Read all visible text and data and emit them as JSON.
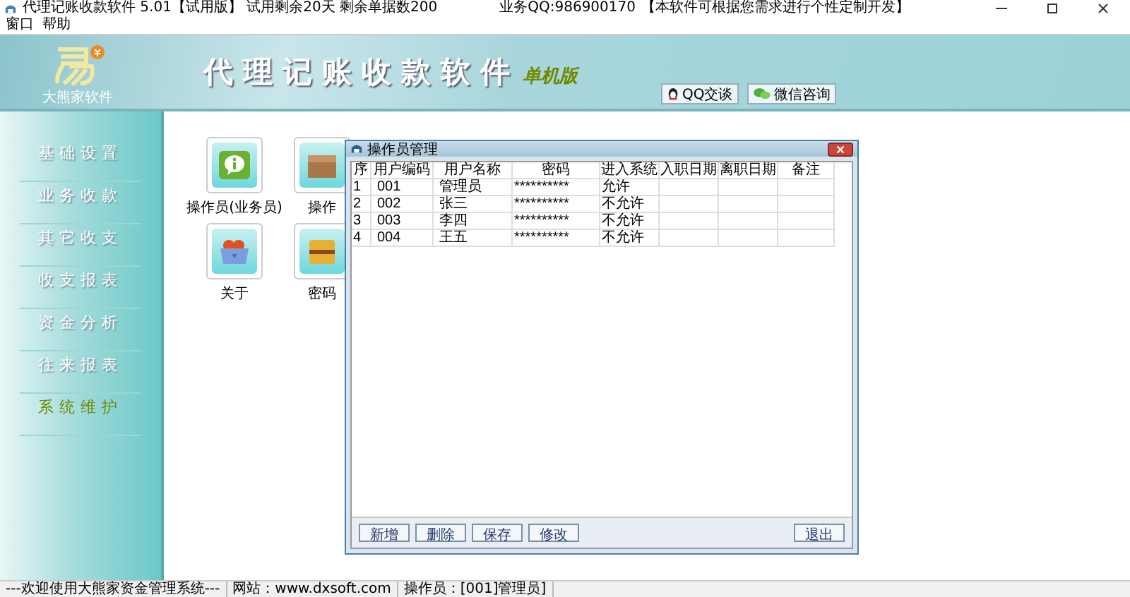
{
  "window": {
    "title": "代理记账收款软件 5.01【试用版】 试用剩余20天  剩余单据数200",
    "contact": "业务QQ:986900170",
    "notice": "【本软件可根据您需求进行个性定制开发】"
  },
  "menu": [
    "窗口",
    "帮助"
  ],
  "header": {
    "brand": "大熊家软件",
    "title": "代理记账收款软件",
    "edition": "单机版",
    "buttons": [
      {
        "label": "QQ交谈",
        "kind": "qq"
      },
      {
        "label": "微信咨询",
        "kind": "wechat"
      }
    ]
  },
  "sidebar": {
    "items": [
      {
        "label": "基础设置",
        "selected": false
      },
      {
        "label": "业务收款",
        "selected": false
      },
      {
        "label": "其它收支",
        "selected": false
      },
      {
        "label": "收支报表",
        "selected": false
      },
      {
        "label": "资金分析",
        "selected": false
      },
      {
        "label": "往来报表",
        "selected": false
      },
      {
        "label": "系统维护",
        "selected": true
      }
    ]
  },
  "tiles": [
    {
      "label": "操作员(业务员)",
      "kind": "info"
    },
    {
      "label": "操作",
      "kind": "box"
    },
    {
      "label": "关于",
      "kind": "basket"
    },
    {
      "label": "密码",
      "kind": "chest"
    }
  ],
  "dialog": {
    "title": "操作员管理",
    "table": {
      "columns": [
        "序",
        "用户编码",
        "用户名称",
        "密码",
        "进入系统",
        "入职日期",
        "离职日期",
        "备注"
      ],
      "rows": [
        [
          "1",
          "001",
          "管理员",
          "**********",
          "允许",
          "",
          "",
          ""
        ],
        [
          "2",
          "002",
          "张三",
          "**********",
          "不允许",
          "",
          "",
          ""
        ],
        [
          "3",
          "003",
          "李四",
          "**********",
          "不允许",
          "",
          "",
          ""
        ],
        [
          "4",
          "004",
          "王五",
          "**********",
          "不允许",
          "",
          "",
          ""
        ]
      ]
    },
    "buttons": [
      "新增",
      "删除",
      "保存",
      "修改"
    ],
    "exit_button": "退出"
  },
  "status_bar": [
    "---欢迎使用大熊家资金管理系统---",
    "网站：www.dxsoft.com",
    "操作员：[001]管理员]"
  ]
}
